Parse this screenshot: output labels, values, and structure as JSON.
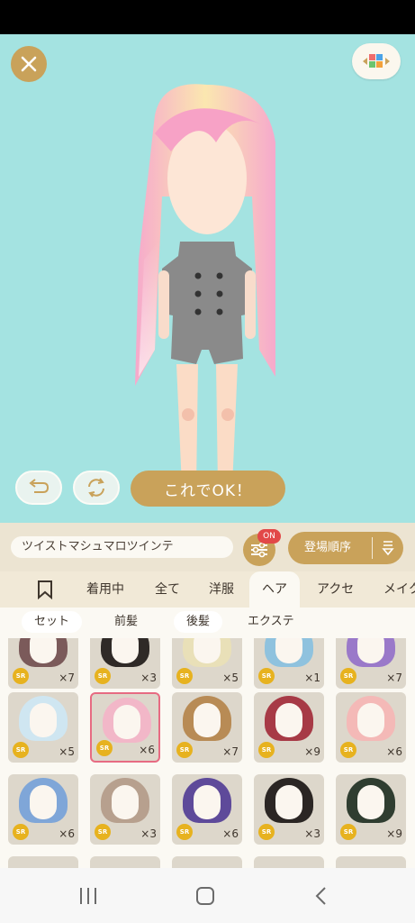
{
  "ok_label": "これでOK！",
  "item_name": "ツイストマシュマロツインテ",
  "filter_badge": "ON",
  "sort_label": "登場順序",
  "tabs": [
    {
      "label": "着用中"
    },
    {
      "label": "全て"
    },
    {
      "label": "洋服"
    },
    {
      "label": "ヘア"
    },
    {
      "label": "アクセ"
    },
    {
      "label": "メイク"
    }
  ],
  "subtabs": [
    {
      "label": "セット"
    },
    {
      "label": "前髪"
    },
    {
      "label": "後髪"
    },
    {
      "label": "エクステ"
    }
  ],
  "rarity": "SR",
  "items": [
    {
      "count": "×7",
      "color": "#7b5a5a"
    },
    {
      "count": "×3",
      "color": "#2f2a27"
    },
    {
      "count": "×5",
      "color": "#e9e0b8"
    },
    {
      "count": "×1",
      "color": "#8fc2de"
    },
    {
      "count": "×7",
      "color": "#9a79c9"
    },
    {
      "count": "×5",
      "color": "#cfe6f1"
    },
    {
      "count": "×6",
      "color": "#f2b7c8"
    },
    {
      "count": "×7",
      "color": "#b88b55"
    },
    {
      "count": "×9",
      "color": "#a73a46"
    },
    {
      "count": "×6",
      "color": "#f4b9b7"
    },
    {
      "count": "×6",
      "color": "#7fa6d8"
    },
    {
      "count": "×3",
      "color": "#b7a08e"
    },
    {
      "count": "×6",
      "color": "#5e4a9a"
    },
    {
      "count": "×3",
      "color": "#2b2624"
    },
    {
      "count": "×9",
      "color": "#2f3d30"
    }
  ],
  "colors": {
    "stage": "#a4e3e1",
    "accent": "#c9a25a",
    "badge": "#e24848",
    "rarity": "#e7b21f",
    "selected": "#e76b82"
  },
  "icons": [
    "close-icon",
    "grid-icon",
    "undo-icon",
    "rotate-icon",
    "filter-icon",
    "sort-icon",
    "bookmark-icon",
    "recent-apps-icon",
    "home-icon",
    "back-icon"
  ]
}
